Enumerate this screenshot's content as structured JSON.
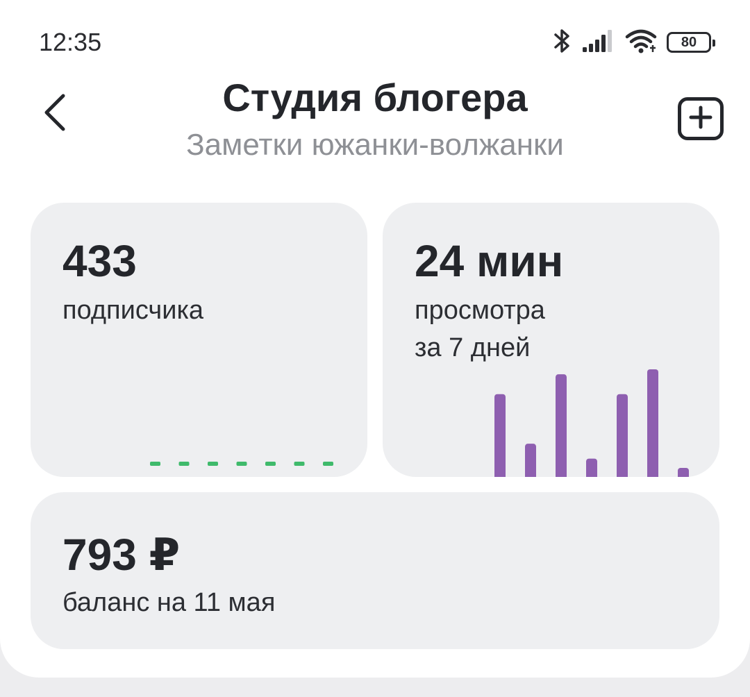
{
  "status_bar": {
    "time": "12:35",
    "battery": "80"
  },
  "header": {
    "title": "Студия блогера",
    "subtitle": "Заметки южанки-волжанки"
  },
  "cards": {
    "subscribers": {
      "value": "433",
      "label": "подписчика"
    },
    "views": {
      "value": "24 мин",
      "label": "просмотра\nза 7 дней"
    },
    "balance": {
      "value": "793 ₽",
      "label": "баланс на 11 мая"
    }
  },
  "colors": {
    "accent_green": "#3fba6b",
    "accent_purple": "#8e5fb0",
    "card_bg": "#eeeff1",
    "subtitle_gray": "#8e9095"
  },
  "chart_data": [
    {
      "type": "line",
      "name": "subscribers-7d",
      "values": [
        0,
        0,
        0,
        0,
        0,
        0,
        0
      ],
      "ylim": [
        0,
        1
      ]
    },
    {
      "type": "bar",
      "name": "views-7d",
      "values": [
        8,
        3,
        10,
        1.5,
        8,
        10.5,
        0.5
      ],
      "ylim": [
        0,
        10.5
      ]
    }
  ]
}
